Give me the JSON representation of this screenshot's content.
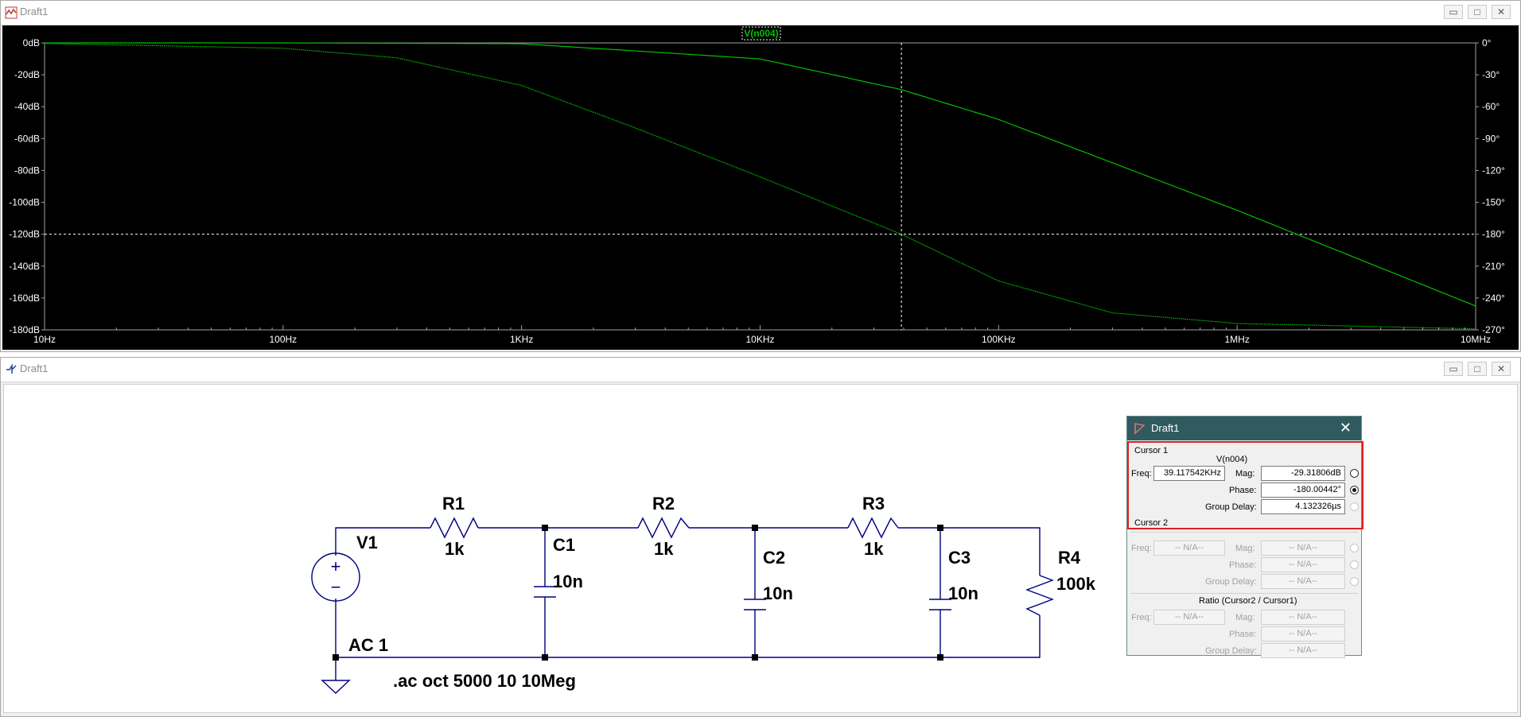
{
  "waveform_window": {
    "title": "Draft1",
    "trace_label": "V(n004)",
    "y_left_ticks": [
      "0dB",
      "-20dB",
      "-40dB",
      "-60dB",
      "-80dB",
      "-100dB",
      "-120dB",
      "-140dB",
      "-160dB",
      "-180dB"
    ],
    "y_right_ticks": [
      "0°",
      "-30°",
      "-60°",
      "-90°",
      "-120°",
      "-150°",
      "-180°",
      "-210°",
      "-240°",
      "-270°"
    ],
    "x_ticks": [
      "10Hz",
      "100Hz",
      "1KHz",
      "10KHz",
      "100KHz",
      "1MHz",
      "10MHz"
    ],
    "colors": {
      "background": "#000000",
      "trace": "#00c000",
      "axis": "#a0a0a0",
      "text": "#ffffff"
    },
    "cursor": {
      "freq_hz": 39117.542,
      "mag_db": -29.31806,
      "phase_deg": -180.00442
    }
  },
  "chart_data": {
    "type": "line",
    "title": "",
    "xscale": "log",
    "xlim": [
      10,
      10000000
    ],
    "ylim_left": [
      -180,
      0
    ],
    "ylim_right": [
      -270,
      0
    ],
    "grid": false,
    "series": [
      {
        "name": "V(n004)",
        "axis": "left",
        "unit": "dB",
        "x": [
          10,
          100,
          1000,
          10000,
          39117.542,
          100000,
          1000000,
          10000000
        ],
        "y": [
          0,
          0,
          -0.5,
          -10,
          -29.3,
          -48,
          -105,
          -165
        ]
      },
      {
        "name": "V(n004)",
        "axis": "right",
        "unit": "°",
        "x": [
          10,
          100,
          300,
          1000,
          3000,
          10000,
          39117.542,
          100000,
          300000,
          1000000,
          10000000
        ],
        "y": [
          -0.5,
          -5,
          -14,
          -40,
          -80,
          -126,
          -180,
          -224,
          -254,
          -264,
          -269
        ]
      }
    ]
  },
  "schematic_window": {
    "title": "Draft1",
    "labels": {
      "v1": "V1",
      "ac": "AC 1",
      "r1": "R1",
      "r1v": "1k",
      "r2": "R2",
      "r2v": "1k",
      "r3": "R3",
      "r3v": "1k",
      "c1": "C1",
      "c1v": "10n",
      "c2": "C2",
      "c2v": "10n",
      "c3": "C3",
      "c3v": "10n",
      "r4": "R4",
      "r4v": "100k",
      "directive": ".ac oct 5000 10 10Meg"
    }
  },
  "cursor_dialog": {
    "title": "Draft1",
    "cursor1": {
      "group": "Cursor 1",
      "trace": "V(n004)",
      "freq_label": "Freq:",
      "freq": "39.117542KHz",
      "mag_label": "Mag:",
      "mag": "-29.31806dB",
      "phase_label": "Phase:",
      "phase": "-180.00442°",
      "gd_label": "Group Delay:",
      "gd": "4.132326µs"
    },
    "cursor2": {
      "group": "Cursor 2",
      "freq_label": "Freq:",
      "freq": "-- N/A--",
      "mag_label": "Mag:",
      "mag": "-- N/A--",
      "phase_label": "Phase:",
      "phase": "-- N/A--",
      "gd_label": "Group Delay:",
      "gd": "-- N/A--"
    },
    "ratio": {
      "group": "Ratio (Cursor2 / Cursor1)",
      "freq_label": "Freq:",
      "freq": "-- N/A--",
      "mag_label": "Mag:",
      "mag": "-- N/A--",
      "phase_label": "Phase:",
      "phase": "-- N/A--",
      "gd_label": "Group Delay:",
      "gd": "-- N/A--"
    },
    "close_glyph": "✕"
  }
}
